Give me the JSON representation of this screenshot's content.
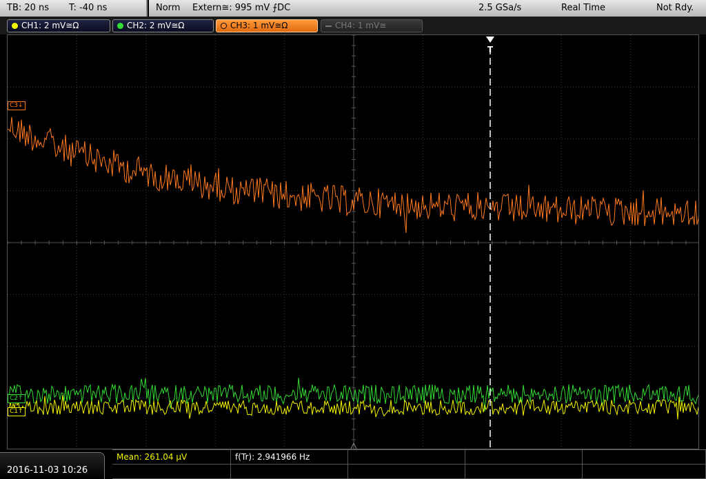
{
  "topbar": {
    "timebase": "TB: 20 ns",
    "trigger_pos": "T: -40 ns",
    "trigger_mode": "Norm",
    "trigger_source": "Extern≅: 995 mV ⨍DC",
    "sample_rate": "2.5 GSa/s",
    "acq_mode": "Real Time",
    "status": "Not Rdy."
  },
  "channels": [
    {
      "label": "CH1: 2 mV≅Ω",
      "color": "#f5f500",
      "state": "on"
    },
    {
      "label": "CH2: 2 mV≅Ω",
      "color": "#33dd33",
      "state": "on"
    },
    {
      "label": "CH3: 1 mV≅Ω",
      "color": "#ff8a2a",
      "state": "active"
    },
    {
      "label": "CH4: 1 mV≅",
      "color": "#777777",
      "state": "off"
    }
  ],
  "markers": {
    "ch3": "C3↓",
    "ch2": "C2↑",
    "ch1": "C1↑",
    "trigger": "T"
  },
  "colors": {
    "ch1": "#f5f500",
    "ch2": "#33dd33",
    "ch3": "#ff7a1e",
    "grid": "#3a3a3a"
  },
  "measurements": {
    "mean": "Mean: 261.04 µV",
    "freq": "f(Tr): 2.941966 Hz"
  },
  "datetime": "2016-11-03 10:26"
}
